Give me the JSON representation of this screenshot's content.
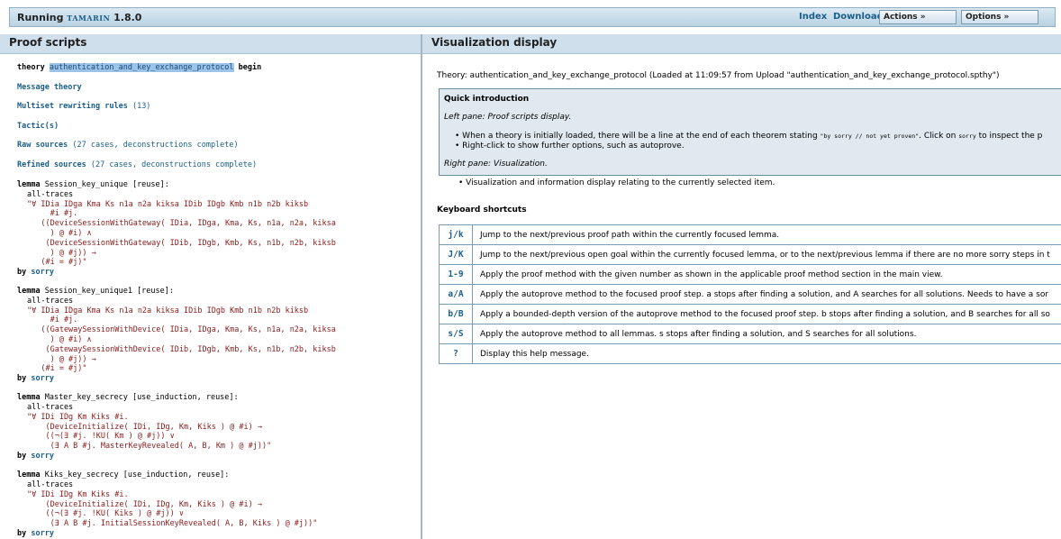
{
  "header": {
    "app_name": "Running",
    "tamarin_name": "TAMARIN",
    "version": "1.8.0",
    "nav": {
      "index": "Index",
      "download": "Download"
    },
    "actions_label": "Actions »",
    "options_label": "Options »"
  },
  "left_pane": {
    "title": "Proof scripts"
  },
  "right_pane": {
    "title": "Visualization display"
  },
  "proof": {
    "theory_kw": "theory",
    "theory_name": "authentication_and_key_exchange_protocol",
    "begin_kw": "begin",
    "message_theory": "Message theory",
    "multiset_rules": "Multiset rewriting rules",
    "multiset_count": "(13)",
    "tactics": "Tactic(s)",
    "raw_sources": "Raw sources",
    "raw_sources_info": "(27 cases, deconstructions complete)",
    "refined_sources": "Refined sources",
    "refined_sources_info": "(27 cases, deconstructions complete)",
    "lemma_kw": "lemma",
    "by_kw": "by",
    "sorry": "sorry",
    "lemmas": [
      {
        "header": "Session_key_unique [reuse]:",
        "lines": [
          "all-traces",
          "\"∀ IDia IDga Kma Ks n1a n2a kiksa IDib IDgb Kmb n1b n2b kiksb",
          "     #i #j.",
          "   ((DeviceSessionWithGateway( IDia, IDga, Kma, Ks, n1a, n2a, kiksa",
          "     ) @ #i) ∧",
          "    (DeviceSessionWithGateway( IDib, IDgb, Kmb, Ks, n1b, n2b, kiksb",
          "     ) @ #j)) →",
          "   (#i = #j)\""
        ]
      },
      {
        "header": "Session_key_unique1 [reuse]:",
        "lines": [
          "all-traces",
          "\"∀ IDia IDga Kma Ks n1a n2a kiksa IDib IDgb Kmb n1b n2b kiksb",
          "     #i #j.",
          "   ((GatewaySessionWithDevice( IDia, IDga, Kma, Ks, n1a, n2a, kiksa",
          "     ) @ #i) ∧",
          "    (GatewaySessionWithDevice( IDib, IDgb, Kmb, Ks, n1b, n2b, kiksb",
          "     ) @ #j)) →",
          "   (#i = #j)\""
        ]
      },
      {
        "header": "Master_key_secrecy [use_induction, reuse]:",
        "lines": [
          "all-traces",
          "\"∀ IDi IDg Km Kiks #i.",
          "    (DeviceInitialize( IDi, IDg, Km, Kiks ) @ #i) →",
          "    ((¬(∃ #j. !KU( Km ) @ #j)) ∨",
          "     (∃ A B #j. MasterKeyRevealed( A, B, Km ) @ #j))\""
        ]
      },
      {
        "header": "Kiks_key_secrecy [use_induction, reuse]:",
        "lines": [
          "all-traces",
          "\"∀ IDi IDg Km Kiks #i.",
          "    (DeviceInitialize( IDi, IDg, Km, Kiks ) @ #i) →",
          "    ((¬(∃ #j. !KU( Kiks ) @ #j)) ∨",
          "     (∃ A B #j. InitialSessionKeyRevealed( A, B, Kiks ) @ #j))\""
        ]
      }
    ]
  },
  "visualization": {
    "theory_line": "Theory: authentication_and_key_exchange_protocol (Loaded at 11:09:57 from Upload \"authentication_and_key_exchange_protocol.spthy\")",
    "quick_intro": {
      "title": "Quick introduction",
      "left_pane_label": "Left pane: Proof scripts display.",
      "bullet1_a": "When a theory is initially loaded, there will be a line at the end of each theorem stating ",
      "bullet1_code": "\"by sorry // not yet proven\"",
      "bullet1_b": ". Click on ",
      "bullet1_code2": "sorry",
      "bullet1_c": " to inspect the p",
      "bullet2": "Right-click to show further options, such as autoprove.",
      "right_pane_label": "Right pane: Visualization.",
      "bullet3": "Visualization and information display relating to the currently selected item."
    },
    "shortcuts_title": "Keyboard shortcuts",
    "shortcuts": [
      {
        "key": "j/k",
        "desc": "Jump to the next/previous proof path within the currently focused lemma."
      },
      {
        "key": "J/K",
        "desc": "Jump to the next/previous open goal within the currently focused lemma, or to the next/previous lemma if there are no more sorry steps in t"
      },
      {
        "key": "1-9",
        "desc": "Apply the proof method with the given number as shown in the applicable proof method section in the main view."
      },
      {
        "key": "a/A",
        "desc": "Apply the autoprove method to the focused proof step. a stops after finding a solution, and A searches for all solutions. Needs to have a sor"
      },
      {
        "key": "b/B",
        "desc": "Apply a bounded-depth version of the autoprove method to the focused proof step. b stops after finding a solution, and B searches for all so"
      },
      {
        "key": "s/S",
        "desc": "Apply the autoprove method to all lemmas. s stops after finding a solution, and S searches for all solutions."
      },
      {
        "key": "?",
        "desc": "Display this help message."
      }
    ]
  }
}
